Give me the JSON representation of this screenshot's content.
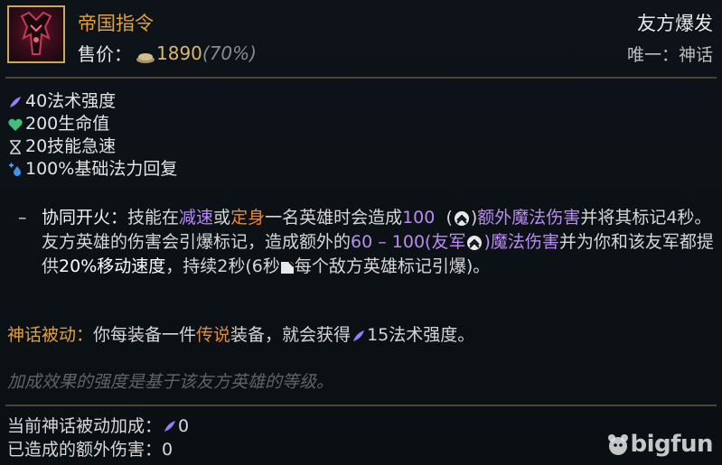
{
  "item": {
    "title": "帝国指令",
    "price_label": "售价：",
    "price": "1890",
    "price_pct": "(70%)",
    "category": "友方爆发",
    "unique": "唯一：神话"
  },
  "stats": [
    {
      "icon": "ability-power-icon",
      "text": "40法术强度"
    },
    {
      "icon": "health-heart-icon",
      "text": "200生命值"
    },
    {
      "icon": "ability-haste-icon",
      "text": "20技能急速"
    },
    {
      "icon": "mana-regen-icon",
      "text": "100%基础法力回复"
    }
  ],
  "passive": {
    "dash": "–",
    "name": "协同开火：",
    "t1": "技能在",
    "slow": "减速",
    "t2": "或",
    "stun": "定身",
    "t3": "一名英雄时会造成",
    "dmg": "100",
    "t4": "(",
    "t5": ")",
    "magic1": "额外魔法伤害",
    "t6": "并将其标记4秒。友方英雄的伤害会引爆标记，造成额外的",
    "range": "60 – 100(友军",
    "range_close": ")",
    "magic2": "魔法伤害",
    "t7": "并为你和该友军都提供",
    "ms": "20%移动速度",
    "t8": "，持续2秒(6秒",
    "t9": "每个敌方英雄标记引爆)。"
  },
  "mythic": {
    "label": "神话被动：",
    "t1": "你每装备一件",
    "legend": "传说",
    "t2": "装备，就会获得",
    "ap": "15法术强度。"
  },
  "note": "加成效果的强度是基于该友方英雄的等级。",
  "footer": {
    "line1_label": "当前神话被动加成：",
    "line1_value": "0",
    "line2_label": "已造成的额外伤害：",
    "line2_value": "0"
  },
  "watermark": "bigfun",
  "colors": {
    "title": "#e0a040",
    "ability_power": "#b889ff",
    "slow_stun": "#e6893a",
    "magic": "#b98cf0",
    "note": "#5e6468"
  }
}
